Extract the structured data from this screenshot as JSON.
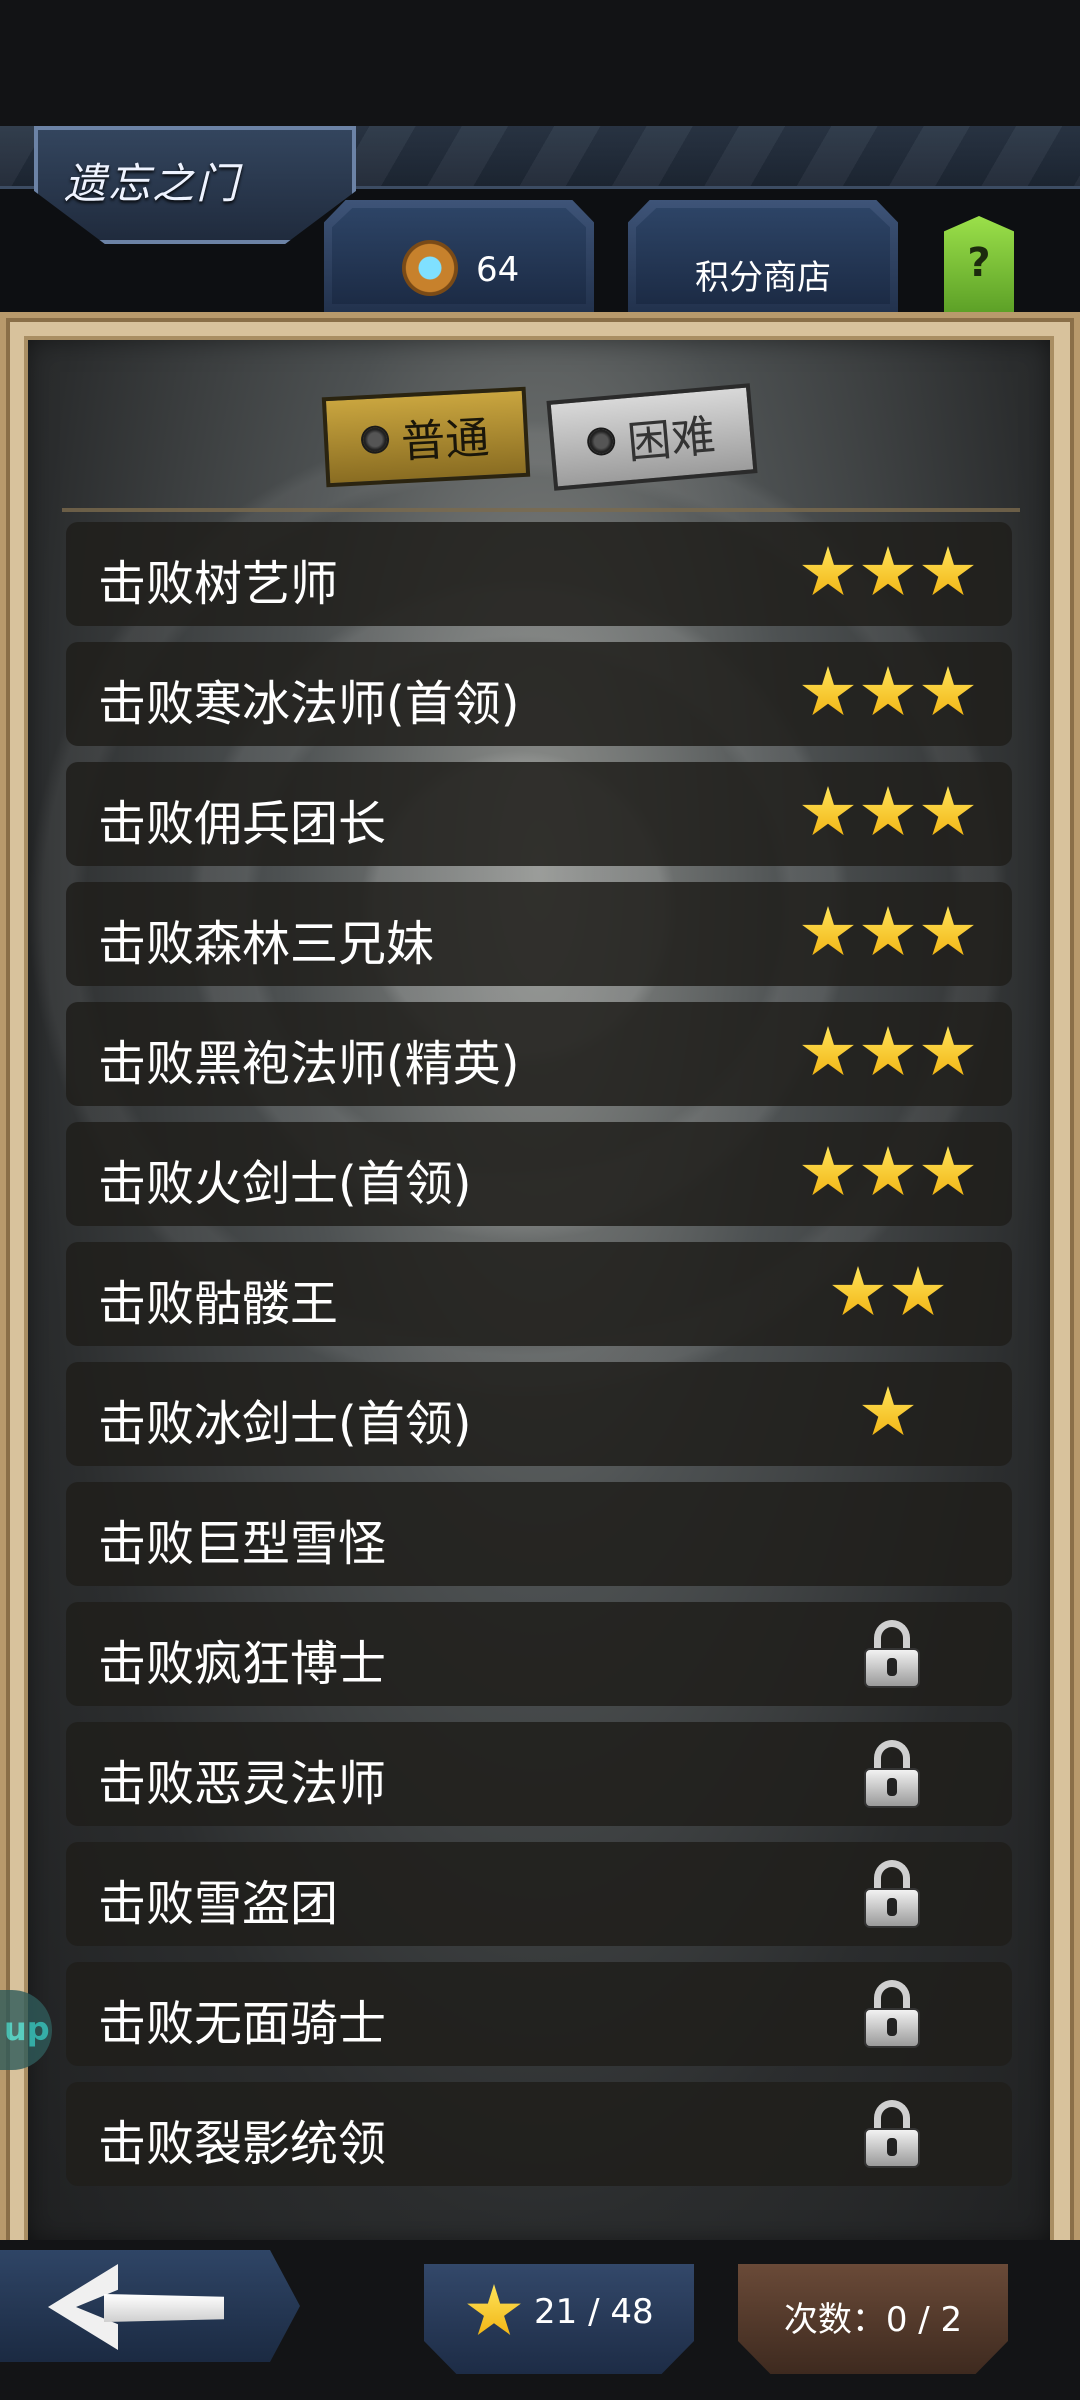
{
  "header": {
    "title": "遗忘之门",
    "points_value": "64",
    "shop_label": "积分商店",
    "help_label": "?"
  },
  "modes": [
    {
      "label": "普通",
      "selected": true
    },
    {
      "label": "困难",
      "selected": false
    }
  ],
  "stages": [
    {
      "label": "击败树艺师",
      "stars": 3,
      "locked": false
    },
    {
      "label": "击败寒冰法师(首领)",
      "stars": 3,
      "locked": false
    },
    {
      "label": "击败佣兵团长",
      "stars": 3,
      "locked": false
    },
    {
      "label": "击败森林三兄妹",
      "stars": 3,
      "locked": false
    },
    {
      "label": "击败黑袍法师(精英)",
      "stars": 3,
      "locked": false
    },
    {
      "label": "击败火剑士(首领)",
      "stars": 3,
      "locked": false
    },
    {
      "label": "击败骷髅王",
      "stars": 2,
      "locked": false
    },
    {
      "label": "击败冰剑士(首领)",
      "stars": 1,
      "locked": false
    },
    {
      "label": "击败巨型雪怪",
      "stars": 0,
      "locked": false
    },
    {
      "label": "击败疯狂博士",
      "stars": 0,
      "locked": true
    },
    {
      "label": "击败恶灵法师",
      "stars": 0,
      "locked": true
    },
    {
      "label": "击败雪盗团",
      "stars": 0,
      "locked": true
    },
    {
      "label": "击败无面骑士",
      "stars": 0,
      "locked": true
    },
    {
      "label": "击败裂影统领",
      "stars": 0,
      "locked": true
    }
  ],
  "footer": {
    "star_count": "21 / 48",
    "tries": "次数：0 / 2"
  },
  "side_tab_label": "up",
  "colors": {
    "star": "#f5c21a",
    "row_bg": "#201e1b",
    "panel": "#d8c29c",
    "header": "#2a3646"
  }
}
